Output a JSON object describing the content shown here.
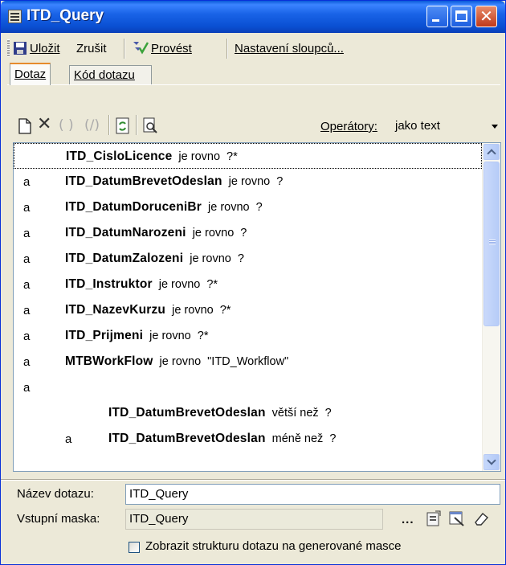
{
  "window": {
    "title": "ITD_Query"
  },
  "toolbar": {
    "save_label": "Uložit",
    "cancel_label": "Zrušit",
    "execute_label": "Provést",
    "columns_label": "Nastavení sloupců..."
  },
  "tabs": [
    {
      "label": "Dotaz",
      "active": true
    },
    {
      "label": "Kód dotazu",
      "active": false
    }
  ],
  "operators": {
    "label": "Operátory:",
    "value": "jako text"
  },
  "conditions": [
    {
      "conj": "",
      "field": "ITD_CisloLicence",
      "op": "je rovno",
      "value": "?*"
    },
    {
      "conj": "a",
      "field": "ITD_DatumBrevetOdeslan",
      "op": "je rovno",
      "value": "?"
    },
    {
      "conj": "a",
      "field": "ITD_DatumDoruceniBr",
      "op": "je rovno",
      "value": "?"
    },
    {
      "conj": "a",
      "field": "ITD_DatumNarozeni",
      "op": "je rovno",
      "value": "?"
    },
    {
      "conj": "a",
      "field": "ITD_DatumZalozeni",
      "op": "je rovno",
      "value": "?"
    },
    {
      "conj": "a",
      "field": "ITD_Instruktor",
      "op": "je rovno",
      "value": "?*"
    },
    {
      "conj": "a",
      "field": "ITD_NazevKurzu",
      "op": "je rovno",
      "value": "?*"
    },
    {
      "conj": "a",
      "field": "ITD_Prijmeni",
      "op": "je rovno",
      "value": "?*"
    },
    {
      "conj": "a",
      "field": "MTBWorkFlow",
      "op": "je rovno",
      "value": "\"ITD_Workflow\""
    },
    {
      "conj": "a",
      "field": "",
      "op": "",
      "value": ""
    },
    {
      "conj": "",
      "field": "ITD_DatumBrevetOdeslan",
      "op": "větší než",
      "value": "?"
    },
    {
      "conj": "a",
      "field": "ITD_DatumBrevetOdeslan",
      "op": "méně než",
      "value": "?"
    }
  ],
  "form": {
    "name_label": "Název dotazu:",
    "name_value": "ITD_Query",
    "mask_label": "Vstupní maska:",
    "mask_value": "ITD_Query",
    "mask_dots": "...",
    "show_structure_label": "Zobrazit strukturu dotazu na generované masce",
    "show_structure_checked": false
  }
}
